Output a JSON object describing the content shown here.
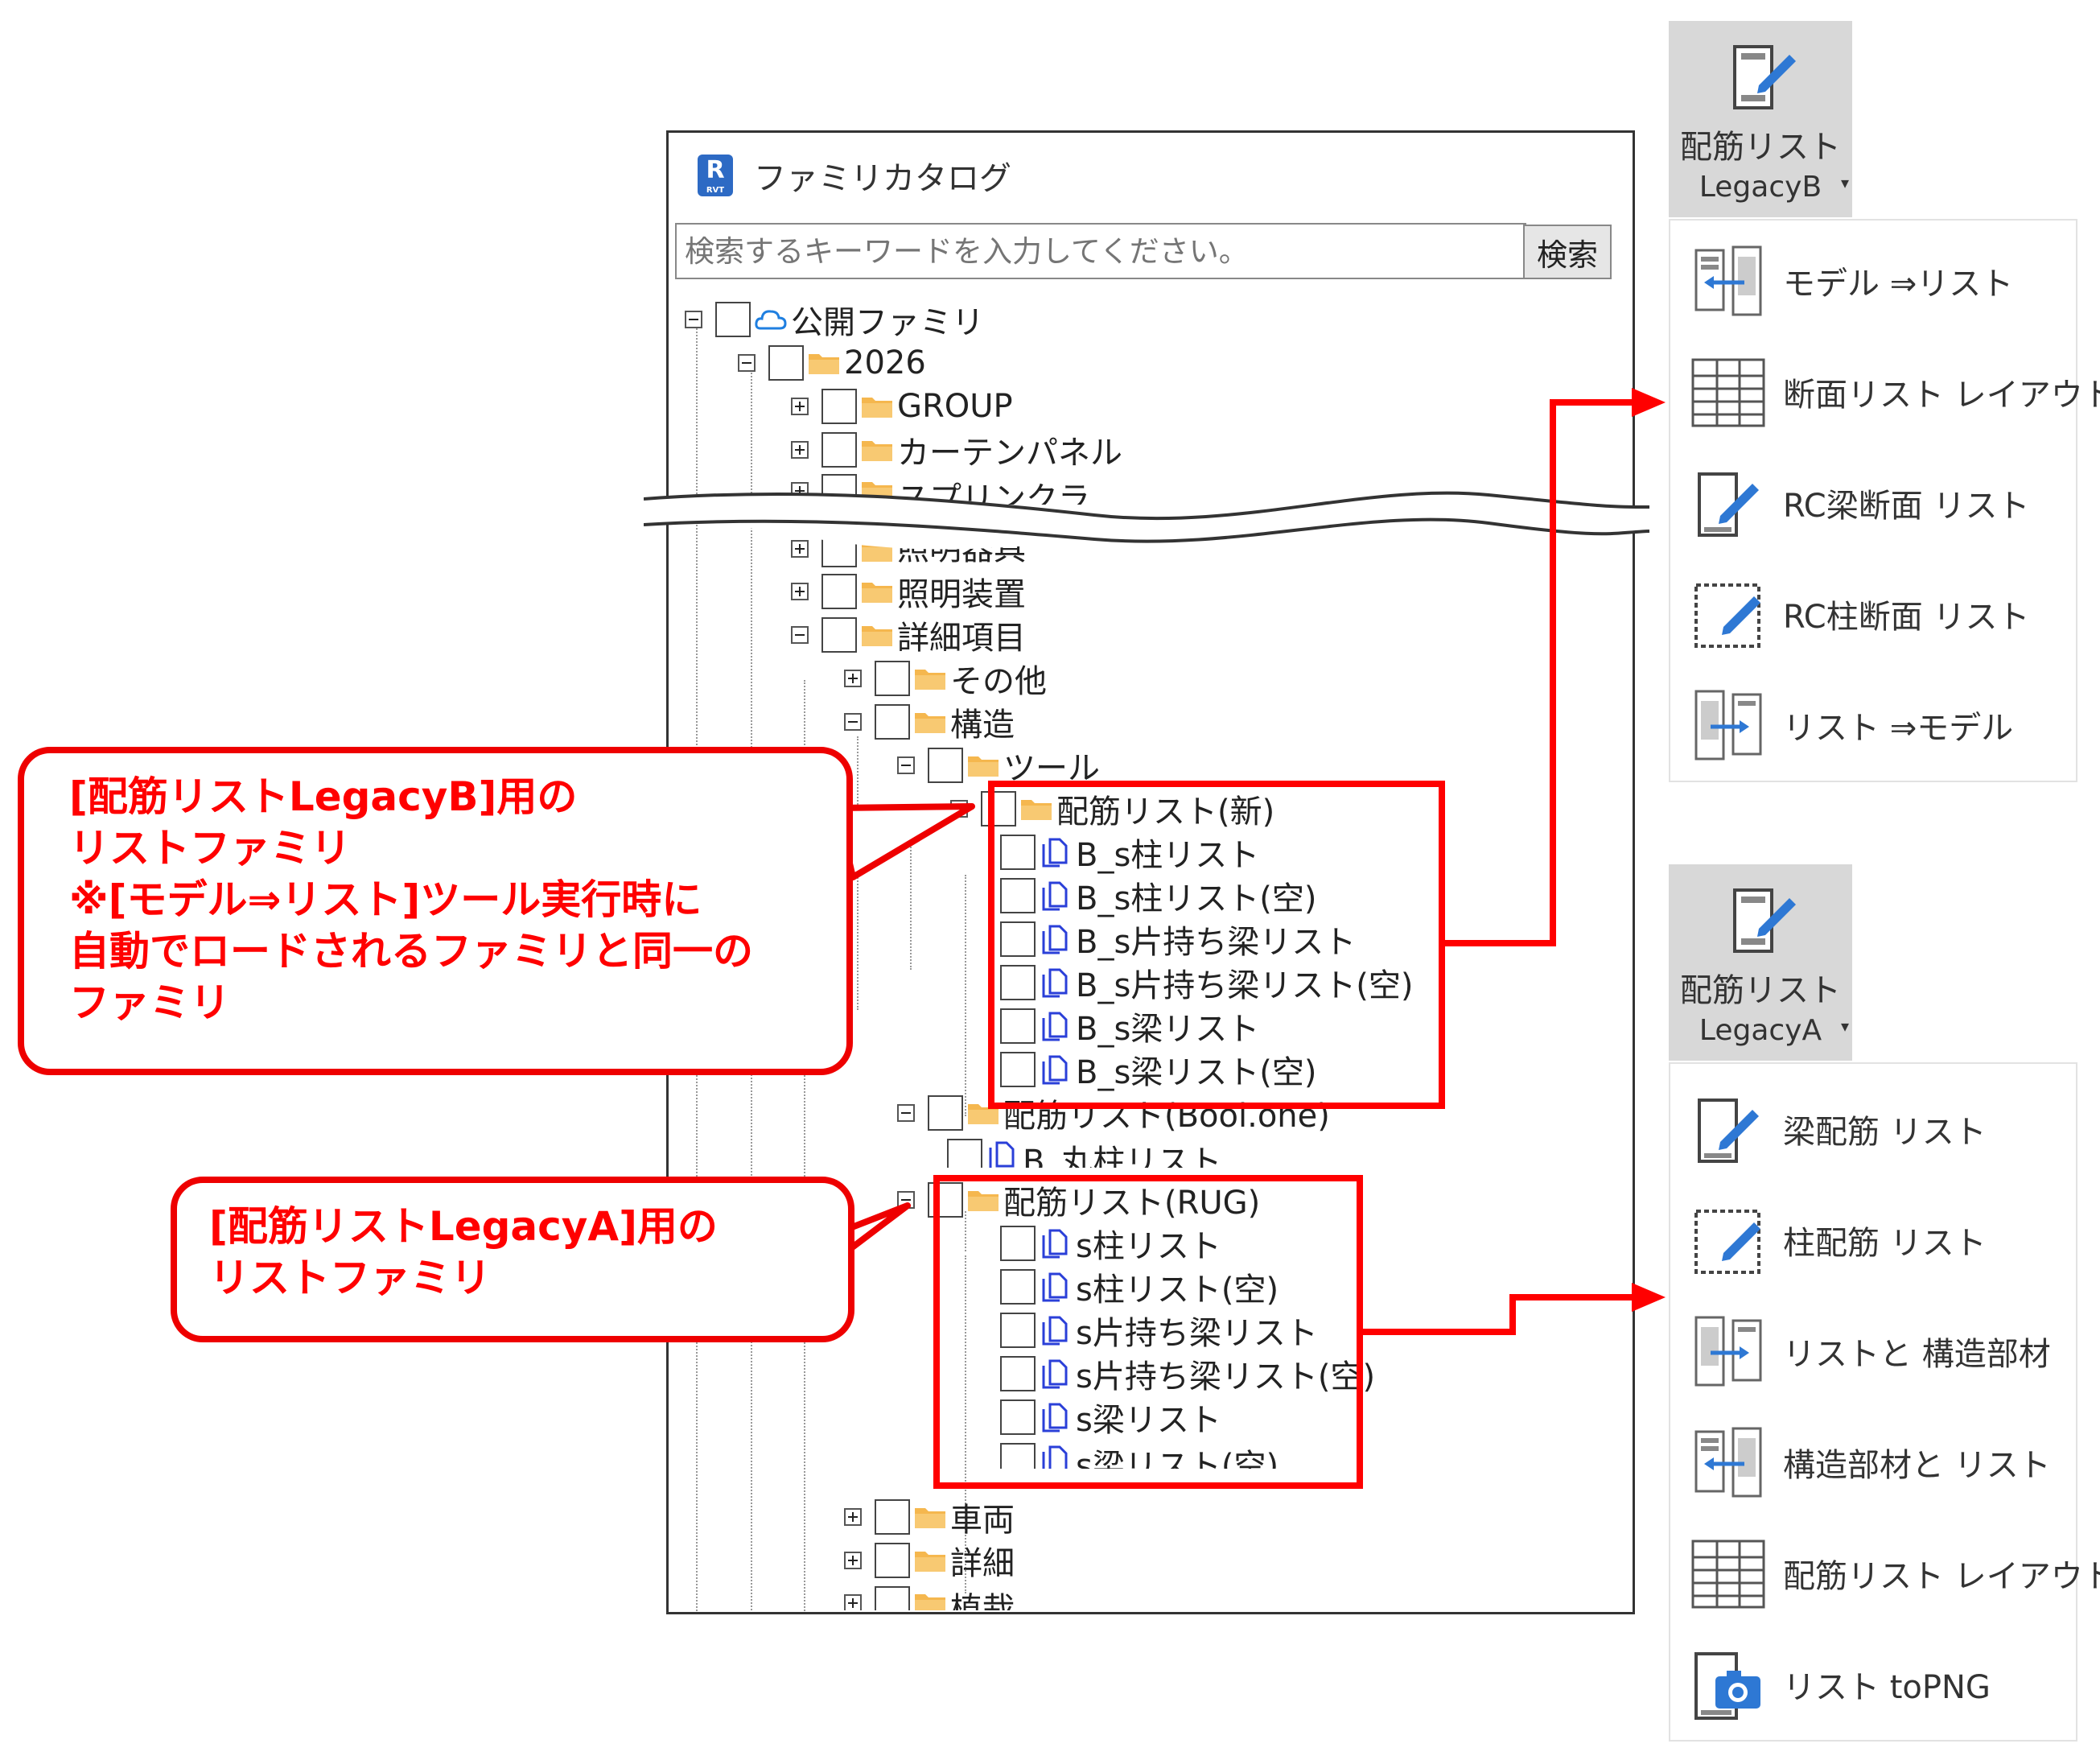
{
  "window": {
    "title": "ファミリカタログ",
    "search_placeholder": "検索するキーワードを入力してください。",
    "search_button": "検索"
  },
  "tree": {
    "root": "公開ファミリ",
    "year": "2026",
    "group": "GROUP",
    "curtain": "カーテンパネル",
    "sprinkler_partial": "スプリンクラ",
    "lighting_fixture": "照明器具",
    "lighting_device": "照明装置",
    "detail_items": "詳細項目",
    "other": "その他",
    "structure": "構造",
    "tool": "ツール",
    "rebar_new": "配筋リスト(新)",
    "new_items": [
      "B_s柱リスト",
      "B_s柱リスト(空)",
      "B_s片持ち梁リスト",
      "B_s片持ち梁リスト(空)",
      "B_s梁リスト",
      "B_s梁リスト(空)"
    ],
    "rebar_bool": "配筋リスト(Bool.one)",
    "bool_item": "B_丸柱リスト",
    "rebar_rug": "配筋リスト(RUG)",
    "rug_items": [
      "s柱リスト",
      "s柱リスト(空)",
      "s片持ち梁リスト",
      "s片持ち梁リスト(空)",
      "s梁リスト",
      "s梁リスト(空)"
    ],
    "vehicle": "車両",
    "detail": "詳細",
    "planting": "植栽"
  },
  "callouts": {
    "b_line1": "[配筋リストLegacyB]用の",
    "b_line2": "リストファミリ",
    "b_line3": "※[モデル⇒リスト]ツール実行時に",
    "b_line4": "自動でロードされるファミリと同一の",
    "b_line5": "ファミリ",
    "a_line1": "[配筋リストLegacyA]用の",
    "a_line2": "リストファミリ"
  },
  "ribbon_b": {
    "label_line1": "配筋リスト",
    "label_line2": "LegacyB",
    "items": [
      "モデル ⇒リスト",
      "断面リスト レイアウト",
      "RC梁断面 リスト",
      "RC柱断面 リスト",
      "リスト ⇒モデル"
    ]
  },
  "ribbon_a": {
    "label_line1": "配筋リスト",
    "label_line2": "LegacyA",
    "items": [
      "梁配筋 リスト",
      "柱配筋 リスト",
      "リストと 構造部材",
      "構造部材と リスト",
      "配筋リスト レイアウト",
      "リスト toPNG"
    ]
  },
  "colors": {
    "highlight": "#ff0000",
    "folder": "#f5b74e",
    "family_icon": "#2a3fd8",
    "ribbon_bg": "#d8d8d8",
    "icon_blue": "#2e78d4"
  }
}
